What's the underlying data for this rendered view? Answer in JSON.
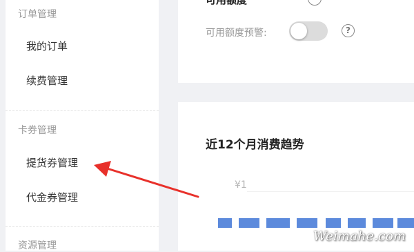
{
  "sidebar": {
    "sections": [
      {
        "title": "订单管理",
        "items": [
          "我的订单",
          "续费管理"
        ]
      },
      {
        "title": "卡券管理",
        "items": [
          "提货券管理",
          "代金券管理"
        ]
      },
      {
        "title": "资源管理",
        "items": []
      }
    ]
  },
  "credit_panel": {
    "clipped_label": "可用额度",
    "warning_label": "可用额度预警:",
    "warning_toggle_on": false
  },
  "chart_panel": {
    "title": "近12个月消费趋势",
    "y_tick": "¥1"
  },
  "chart_data": {
    "type": "bar",
    "title": "近12个月消费趋势",
    "ytick_labels": [
      "¥1"
    ]
  },
  "annotation": {
    "arrow_color": "#e8302a",
    "target": "提货券管理"
  },
  "watermark": "Weimahe.com",
  "colors": {
    "background": "#f0f1f4",
    "section_title": "#999999",
    "menu_text": "#333333",
    "bar": "#3f76d6"
  }
}
